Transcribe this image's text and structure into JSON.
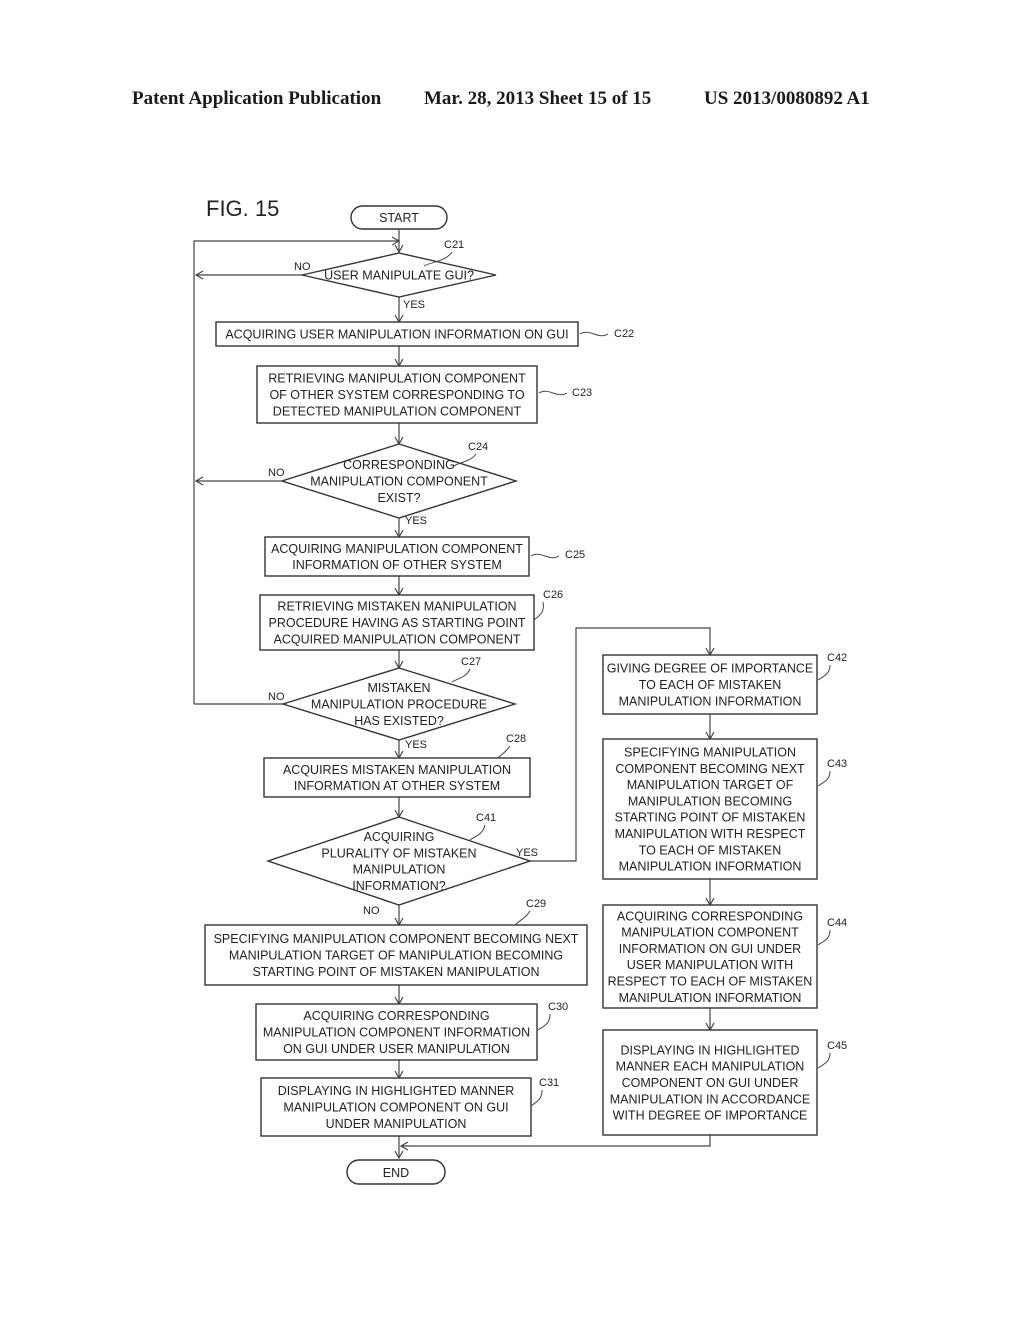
{
  "header": {
    "publication": "Patent Application Publication",
    "date_sheet": "Mar. 28, 2013  Sheet 15 of 15",
    "number": "US 2013/0080892 A1"
  },
  "figure": {
    "label": "FIG. 15",
    "start": "START",
    "end": "END",
    "branch_labels": {
      "yes": "YES",
      "no": "NO"
    },
    "steps": {
      "C21": {
        "ref": "C21",
        "type": "decision",
        "lines": [
          "USER MANIPULATE GUI?"
        ]
      },
      "C22": {
        "ref": "C22",
        "type": "process",
        "lines": [
          "ACQUIRING USER MANIPULATION INFORMATION ON GUI"
        ]
      },
      "C23": {
        "ref": "C23",
        "type": "process",
        "lines": [
          "RETRIEVING MANIPULATION COMPONENT",
          "OF OTHER SYSTEM CORRESPONDING TO",
          "DETECTED MANIPULATION COMPONENT"
        ]
      },
      "C24": {
        "ref": "C24",
        "type": "decision",
        "lines": [
          "CORRESPONDING",
          "MANIPULATION COMPONENT",
          "EXIST?"
        ]
      },
      "C25": {
        "ref": "C25",
        "type": "process",
        "lines": [
          "ACQUIRING MANIPULATION COMPONENT",
          "INFORMATION OF OTHER SYSTEM"
        ]
      },
      "C26": {
        "ref": "C26",
        "type": "process",
        "lines": [
          "RETRIEVING MISTAKEN MANIPULATION",
          "PROCEDURE HAVING AS STARTING POINT",
          "ACQUIRED MANIPULATION COMPONENT"
        ]
      },
      "C27": {
        "ref": "C27",
        "type": "decision",
        "lines": [
          "MISTAKEN",
          "MANIPULATION PROCEDURE",
          "HAS EXISTED?"
        ]
      },
      "C28": {
        "ref": "C28",
        "type": "process",
        "lines": [
          "ACQUIRES MISTAKEN MANIPULATION",
          "INFORMATION AT OTHER SYSTEM"
        ]
      },
      "C41": {
        "ref": "C41",
        "type": "decision",
        "lines": [
          "ACQUIRING",
          "PLURALITY OF MISTAKEN",
          "MANIPULATION",
          "INFORMATION?"
        ]
      },
      "C29": {
        "ref": "C29",
        "type": "process",
        "lines": [
          "SPECIFYING MANIPULATION COMPONENT BECOMING NEXT",
          "MANIPULATION TARGET OF MANIPULATION BECOMING",
          "STARTING POINT OF MISTAKEN MANIPULATION"
        ]
      },
      "C30": {
        "ref": "C30",
        "type": "process",
        "lines": [
          "ACQUIRING CORRESPONDING",
          "MANIPULATION COMPONENT INFORMATION",
          "ON GUI UNDER USER MANIPULATION"
        ]
      },
      "C31": {
        "ref": "C31",
        "type": "process",
        "lines": [
          "DISPLAYING IN HIGHLIGHTED MANNER",
          "MANIPULATION COMPONENT ON GUI",
          "UNDER MANIPULATION"
        ]
      },
      "C42": {
        "ref": "C42",
        "type": "process",
        "lines": [
          "GIVING DEGREE OF IMPORTANCE",
          "TO EACH OF MISTAKEN",
          "MANIPULATION INFORMATION"
        ]
      },
      "C43": {
        "ref": "C43",
        "type": "process",
        "lines": [
          "SPECIFYING MANIPULATION",
          "COMPONENT BECOMING NEXT",
          "MANIPULATION TARGET OF",
          "MANIPULATION BECOMING",
          "STARTING POINT OF MISTAKEN",
          "MANIPULATION WITH RESPECT",
          "TO EACH OF MISTAKEN",
          "MANIPULATION INFORMATION"
        ]
      },
      "C44": {
        "ref": "C44",
        "type": "process",
        "lines": [
          "ACQUIRING CORRESPONDING",
          "MANIPULATION COMPONENT",
          "INFORMATION ON GUI UNDER",
          "USER MANIPULATION WITH",
          "RESPECT TO EACH OF MISTAKEN",
          "MANIPULATION INFORMATION"
        ]
      },
      "C45": {
        "ref": "C45",
        "type": "process",
        "lines": [
          "DISPLAYING IN HIGHLIGHTED",
          "MANNER EACH MANIPULATION",
          "COMPONENT ON GUI UNDER",
          "MANIPULATION IN ACCORDANCE",
          "WITH DEGREE OF IMPORTANCE"
        ]
      }
    }
  }
}
